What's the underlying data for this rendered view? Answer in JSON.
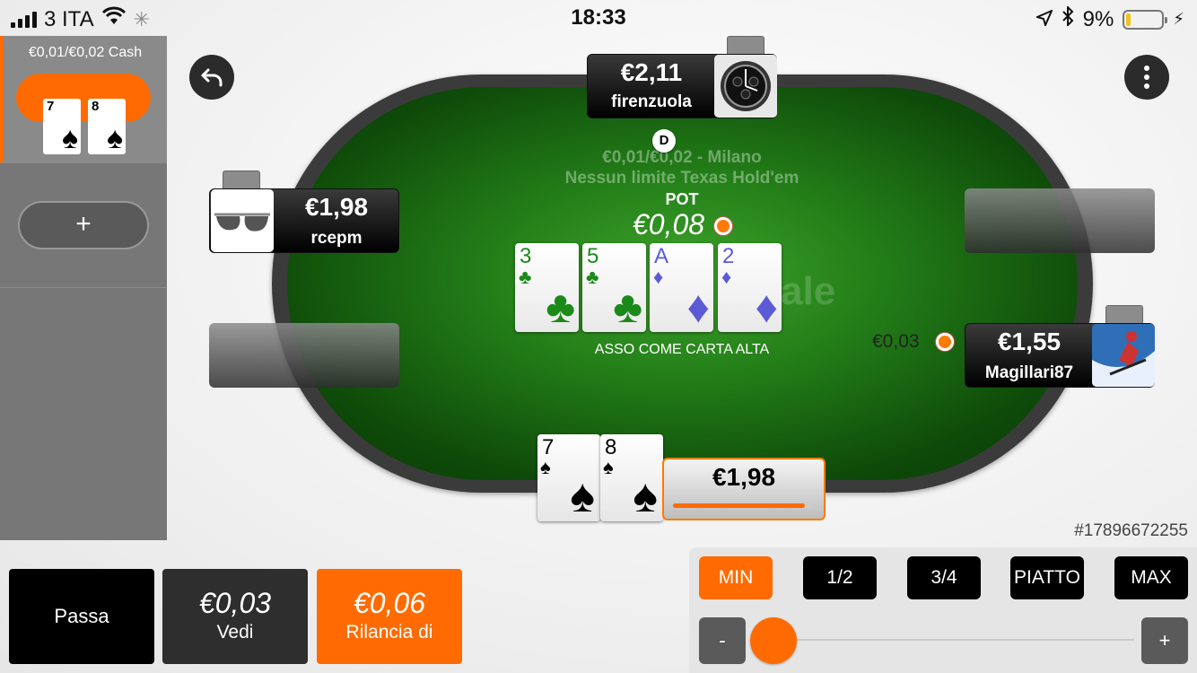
{
  "status": {
    "carrier": "3 ITA",
    "time": "18:33",
    "battery": "9%",
    "battery_level": 0.09
  },
  "sidebar": {
    "tables": [
      {
        "stakes": "€0,01/€0,02 Cash",
        "cards": [
          {
            "rank": "7",
            "suit": "♠"
          },
          {
            "rank": "8",
            "suit": "♠"
          }
        ]
      }
    ],
    "add_table_label": "+"
  },
  "table": {
    "info_line1": "€0,01/€0,02 - Milano",
    "info_line2": "Nessun limite Texas Hold'em",
    "watermark": "ale",
    "dealer": "D",
    "pot_label": "POT",
    "pot": "€0,08",
    "board": [
      {
        "rank": "3",
        "suit": "♣"
      },
      {
        "rank": "5",
        "suit": "♣"
      },
      {
        "rank": "A",
        "suit": "♦"
      },
      {
        "rank": "2",
        "suit": "♦"
      }
    ],
    "hand_strength": "ASSO COME CARTA ALTA",
    "hand_id": "#17896672255"
  },
  "players": {
    "top": {
      "name": "firenzuola",
      "stack": "€2,11"
    },
    "left": {
      "name": "rcepm",
      "stack": "€1,98"
    },
    "right": {
      "name": "Magillari87",
      "stack": "€1,55",
      "bet": "€0,03"
    }
  },
  "hero": {
    "cards": [
      {
        "rank": "7",
        "suit": "♠"
      },
      {
        "rank": "8",
        "suit": "♠"
      }
    ],
    "stack": "€1,98",
    "timer_fraction": 0.93
  },
  "actions": {
    "fold": "Passa",
    "call_amount": "€0,03",
    "call": "Vedi",
    "raise_amount": "€0,06",
    "raise": "Rilancia di"
  },
  "bet_panel": {
    "presets": [
      "MIN",
      "1/2",
      "3/4",
      "PIATTO",
      "MAX"
    ],
    "minus": "-",
    "plus": "+",
    "slider_fraction": 0.0
  },
  "colors": {
    "accent": "#ff6b00",
    "felt": "#237e18",
    "clubs": "#1a8a1a",
    "diamonds": "#5b5bd6"
  }
}
